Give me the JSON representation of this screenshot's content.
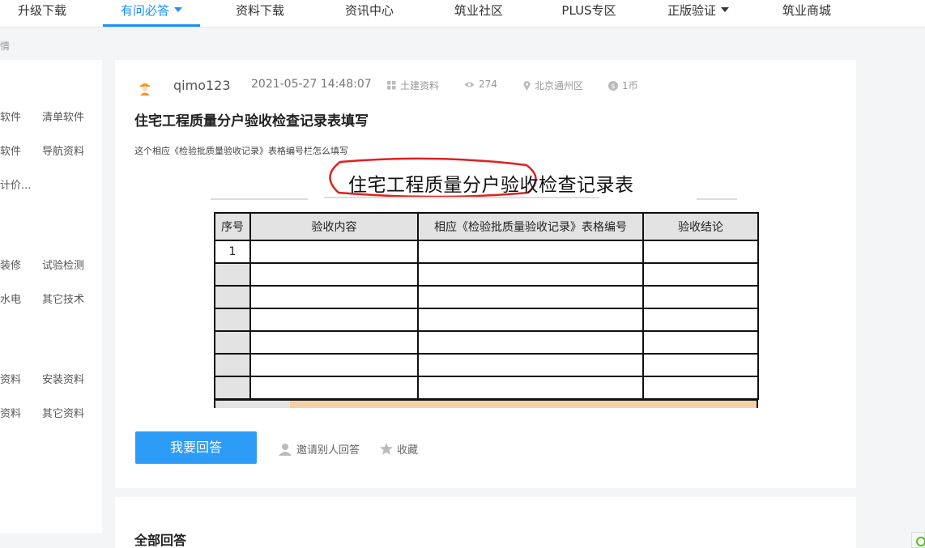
{
  "nav": {
    "items": [
      {
        "label": "升级下载",
        "active": false,
        "dropdown": false
      },
      {
        "label": "有问必答",
        "active": true,
        "dropdown": true
      },
      {
        "label": "资料下载",
        "active": false,
        "dropdown": false
      },
      {
        "label": "资讯中心",
        "active": false,
        "dropdown": false
      },
      {
        "label": "筑业社区",
        "active": false,
        "dropdown": false
      },
      {
        "label": "PLUS专区",
        "active": false,
        "dropdown": false
      },
      {
        "label": "正版验证",
        "active": false,
        "dropdown": true
      },
      {
        "label": "筑业商城",
        "active": false,
        "dropdown": false
      }
    ],
    "accent_color": "#1890ff"
  },
  "breadcrumb": "情",
  "sidebar": {
    "links": [
      "软件",
      "清单软件",
      "软件",
      "导航资料",
      "计价...",
      "装修",
      "试验检测",
      "水电",
      "其它技术",
      "资料",
      "安装资料",
      "资料",
      "其它资料"
    ]
  },
  "question": {
    "username": "qimo123",
    "timestamp": "2021-05-27 14:48:07",
    "category": "土建资料",
    "views": "274",
    "location": "北京通州区",
    "reward": "1币",
    "title": "住宅工程质量分户验收检查记录表填写",
    "description": "这个相应《检验批质量验收记录》表格编号栏怎么填写",
    "image": {
      "form_title": "住宅工程质量分户验收检查记录表",
      "headers": [
        "序号",
        "验收内容",
        "相应《检验批质量验收记录》表格编号",
        "验收结论"
      ],
      "first_row_index": "1",
      "annotation_color": "#e02020"
    }
  },
  "actions": {
    "answer_button": "我要回答",
    "invite_label": "邀请别人回答",
    "favorite_label": "收藏",
    "button_color": "#2d9cf7"
  },
  "answers": {
    "title": "全部回答"
  }
}
